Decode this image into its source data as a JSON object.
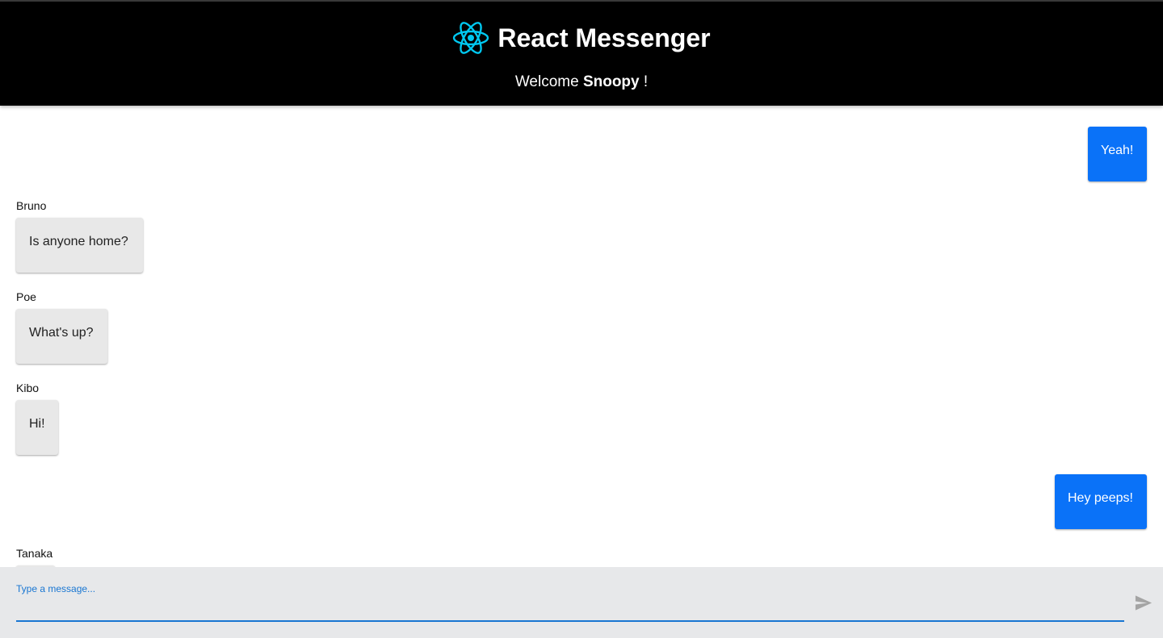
{
  "header": {
    "logo_icon": "react-atom-icon",
    "title": "React Messenger",
    "welcome_prefix": "Welcome",
    "username": "Snoopy",
    "welcome_suffix": "!"
  },
  "colors": {
    "header_bg": "#000000",
    "logo": "#00c8f0",
    "own_bubble": "#0a72f8",
    "other_bubble": "#e8e8e8",
    "composer_bg": "#e7e8ea",
    "accent": "#1976d2"
  },
  "messages": [
    {
      "sender": "",
      "text": "Yeah!",
      "own": true
    },
    {
      "sender": "Bruno",
      "text": "Is anyone home?",
      "own": false
    },
    {
      "sender": "Poe",
      "text": "What's up?",
      "own": false
    },
    {
      "sender": "Kibo",
      "text": "Hi!",
      "own": false
    },
    {
      "sender": "",
      "text": "Hey peeps!",
      "own": true
    },
    {
      "sender": "Tanaka",
      "text": "",
      "own": false
    }
  ],
  "composer": {
    "label": "Type a message...",
    "value": "",
    "send_icon": "send-icon"
  }
}
